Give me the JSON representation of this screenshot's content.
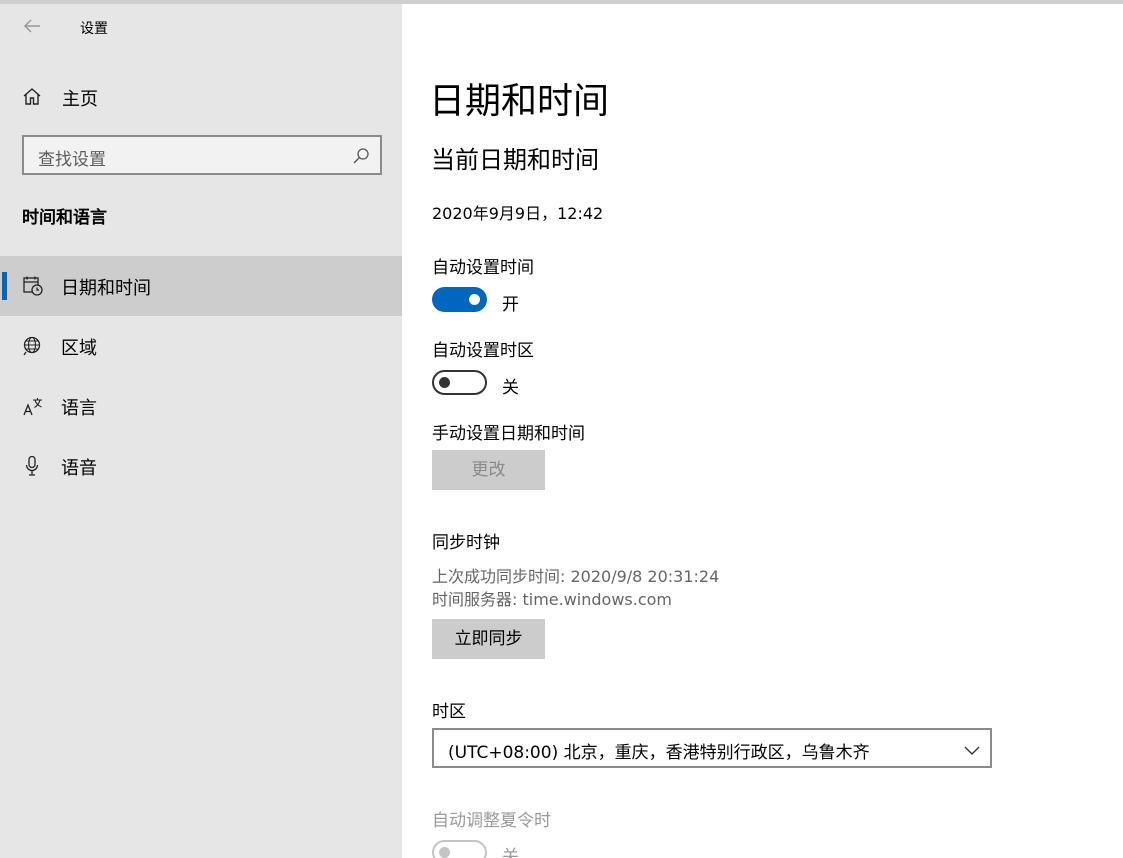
{
  "window": {
    "title": "设置"
  },
  "sidebar": {
    "home_label": "主页",
    "search_placeholder": "查找设置",
    "section_title": "时间和语言",
    "items": [
      {
        "label": "日期和时间",
        "icon": "calendar-clock-icon",
        "active": true
      },
      {
        "label": "区域",
        "icon": "globe-icon",
        "active": false
      },
      {
        "label": "语言",
        "icon": "language-icon",
        "active": false
      },
      {
        "label": "语音",
        "icon": "microphone-icon",
        "active": false
      }
    ]
  },
  "main": {
    "title": "日期和时间",
    "subtitle": "当前日期和时间",
    "current_datetime": "2020年9月9日，12:42",
    "auto_time": {
      "label": "自动设置时间",
      "state": "开"
    },
    "auto_timezone": {
      "label": "自动设置时区",
      "state": "关"
    },
    "manual": {
      "label": "手动设置日期和时间",
      "button": "更改"
    },
    "sync": {
      "label": "同步时钟",
      "last_sync": "上次成功同步时间: 2020/9/8 20:31:24",
      "server": "时间服务器: time.windows.com",
      "button": "立即同步"
    },
    "timezone": {
      "label": "时区",
      "value": "(UTC+08:00) 北京，重庆，香港特别行政区，乌鲁木齐"
    },
    "dst": {
      "label": "自动调整夏令时",
      "state": "关"
    }
  },
  "colors": {
    "accent": "#0067c0",
    "sidebar_bg": "#e6e6e6",
    "active_bg": "#cdcdcd"
  }
}
